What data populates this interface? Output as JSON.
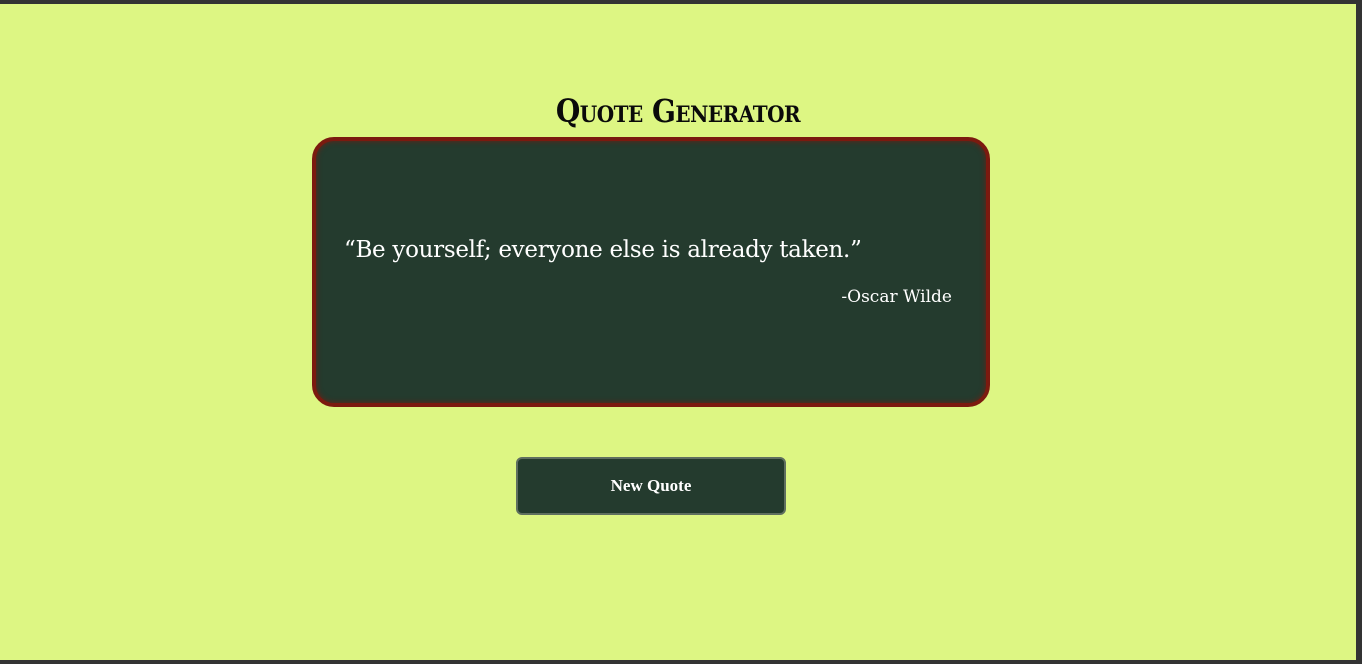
{
  "page": {
    "title": "Quote Generator"
  },
  "quote": {
    "text": "“Be yourself; everyone else is already taken.”",
    "author": "-Oscar Wilde"
  },
  "actions": {
    "new_quote_label": "New Quote"
  },
  "colors": {
    "background": "#ddf683",
    "card": "#243b2e",
    "card_border": "#7b1a0f",
    "text_light": "#ffffff",
    "title": "#0a0a0a"
  }
}
